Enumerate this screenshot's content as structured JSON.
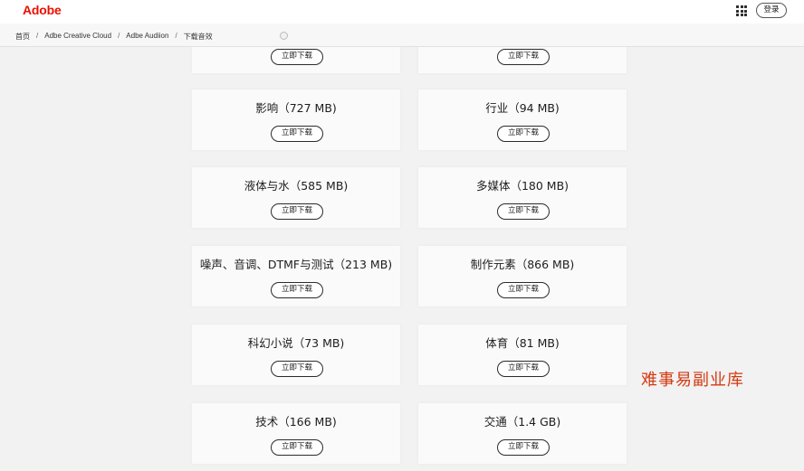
{
  "header": {
    "logo": "Adobe",
    "apps_icon": "grid-apps-icon",
    "signin_label": "登录"
  },
  "breadcrumb": [
    "首页",
    "Adbe Creative Cloud",
    "Adbe Audiion",
    "下载音效"
  ],
  "breadcrumb_separator": "/",
  "cards": [
    {
      "title": "",
      "button": "立即下载"
    },
    {
      "title": "",
      "button": "立即下载"
    },
    {
      "title": "影响（727 MB)",
      "button": "立即下载"
    },
    {
      "title": "行业（94 MB)",
      "button": "立即下载"
    },
    {
      "title": "液体与水（585 MB)",
      "button": "立即下载"
    },
    {
      "title": "多媒体（180 MB)",
      "button": "立即下载"
    },
    {
      "title": "噪声、音调、DTMF与测试（213 MB)",
      "button": "立即下载"
    },
    {
      "title": "制作元素（866 MB)",
      "button": "立即下载"
    },
    {
      "title": "科幻小说（73 MB)",
      "button": "立即下载"
    },
    {
      "title": "体育（81 MB)",
      "button": "立即下载"
    },
    {
      "title": "技术（166 MB)",
      "button": "立即下载"
    },
    {
      "title": "交通（1.4 GB)",
      "button": "立即下载"
    }
  ],
  "watermark": "难事易副业库",
  "colors": {
    "brand": "#eb1000",
    "watermark": "#d43a12",
    "background": "#f2f2f2"
  }
}
